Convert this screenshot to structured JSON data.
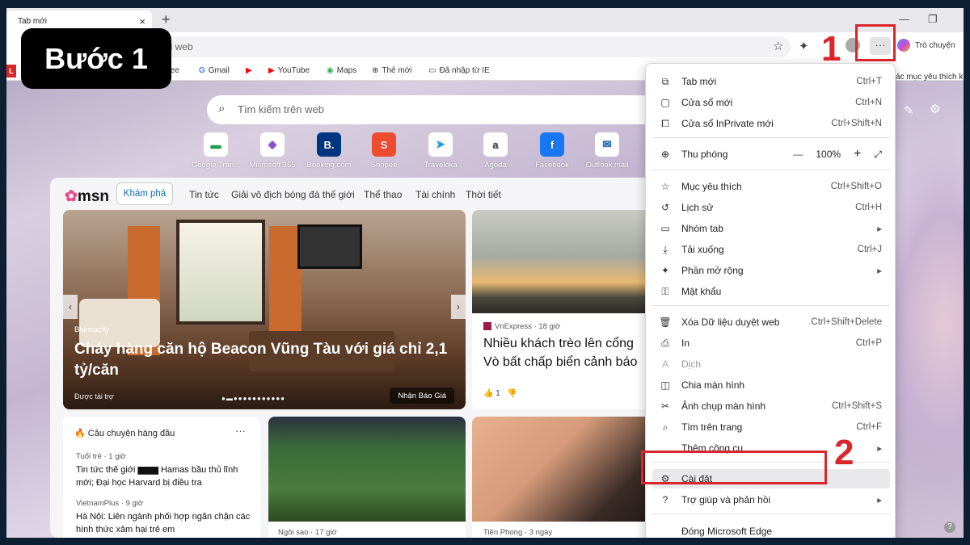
{
  "badge": "Bước 1",
  "step_numbers": [
    "1",
    "2"
  ],
  "tab": {
    "title": "Tab mới",
    "close": "×",
    "new": "+"
  },
  "window": {
    "minimize": "—",
    "restore": "❐"
  },
  "address": {
    "text": "hi web"
  },
  "chat_label": "Trò chuyện",
  "bookmarks": [
    {
      "label": "fee"
    },
    {
      "label": "Gmail"
    },
    {
      "label": "YouTube"
    },
    {
      "label": "Maps"
    },
    {
      "label": "Thẻ mới"
    },
    {
      "label": "Đã nhập từ IE"
    }
  ],
  "bookmarks_right": "ác mục yêu thích khá",
  "search": {
    "placeholder": "Tìm kiếm trên web"
  },
  "quick_links": [
    {
      "label": "Google Tran...",
      "icon": "google-translate-icon",
      "glyph": "▬",
      "color": "#1a9e4b"
    },
    {
      "label": "Microsoft 365",
      "icon": "m365-icon",
      "glyph": "◆",
      "color": "#8e4ccf"
    },
    {
      "label": "Booking.com",
      "icon": "booking-icon",
      "glyph": "B.",
      "color": "#003580"
    },
    {
      "label": "Shopee",
      "icon": "shopee-icon",
      "glyph": "S",
      "color": "#ee4d2d"
    },
    {
      "label": "Traveloka",
      "icon": "traveloka-icon",
      "glyph": "➤",
      "color": "#1ba0e2"
    },
    {
      "label": "Agoda",
      "icon": "agoda-icon",
      "glyph": "a",
      "color": "#444"
    },
    {
      "label": "Facebook",
      "icon": "facebook-icon",
      "glyph": "f",
      "color": "#1877f2"
    },
    {
      "label": "Outlook mail",
      "icon": "outlook-icon",
      "glyph": "✉",
      "color": "#0f6cbd"
    }
  ],
  "msn": {
    "logo": "msn",
    "nav": [
      "Khám phá",
      "Tin tức",
      "Giải vô địch bóng đá thế giới",
      "Thể thao",
      "Tài chính",
      "Thời tiết"
    ]
  },
  "hero": {
    "source": "Blancacity",
    "title": "Cháy hàng căn hộ Beacon Vũng Tàu với giá chỉ 2,1 tỷ/căn",
    "sponsored": "Được tài trợ",
    "cta": "Nhận Báo Giá",
    "dots": "●▬●●●●●●●●●●●"
  },
  "card2": {
    "source": "VnExpress · 18 giờ",
    "title_line1": "Nhiều khách trèo lên cổng",
    "title_line2": "Vò bất chấp biển cảnh báo",
    "likes": "1"
  },
  "top_stories": {
    "header": "Câu chuyện hàng đầu",
    "more": "···",
    "items": [
      {
        "source": "Tuổi trẻ · 1 giờ",
        "title": "Tin tức thế giới ▆▆▆ Hamas bầu thủ lĩnh mới; Đại học Harvard bị điều tra"
      },
      {
        "source": "VietnamPlus · 9 giờ",
        "title": "Hà Nội: Liên ngành phối hợp ngăn chặn các hình thức xâm hại trẻ em"
      }
    ]
  },
  "card4": {
    "source": "Ngôi sao · 17 giờ"
  },
  "card5": {
    "source": "Tiền Phong · 3 ngày"
  },
  "menu": {
    "items": [
      {
        "icon": "new-tab-icon",
        "glyph": "⧉",
        "label": "Tab mới",
        "shortcut": "Ctrl+T"
      },
      {
        "icon": "new-window-icon",
        "glyph": "▢",
        "label": "Cửa sổ mới",
        "shortcut": "Ctrl+N"
      },
      {
        "icon": "inprivate-icon",
        "glyph": "⧠",
        "label": "Cửa sổ InPrivate mới",
        "shortcut": "Ctrl+Shift+N"
      },
      {
        "icon": "favorites-icon",
        "glyph": "☆",
        "label": "Mục yêu thích",
        "shortcut": "Ctrl+Shift+O"
      },
      {
        "icon": "history-icon",
        "glyph": "↺",
        "label": "Lịch sử",
        "shortcut": "Ctrl+H"
      },
      {
        "icon": "tab-groups-icon",
        "glyph": "▭",
        "label": "Nhóm tab",
        "shortcut": "▸"
      },
      {
        "icon": "download-icon",
        "glyph": "⤓",
        "label": "Tải xuống",
        "shortcut": "Ctrl+J"
      },
      {
        "icon": "extensions-icon",
        "glyph": "✦",
        "label": "Phần mở rộng",
        "shortcut": "▸"
      },
      {
        "icon": "password-icon",
        "glyph": "⚿",
        "label": "Mật khẩu",
        "shortcut": ""
      },
      {
        "icon": "delete-icon",
        "glyph": "🗑",
        "label": "Xóa Dữ liệu duyệt web",
        "shortcut": "Ctrl+Shift+Delete"
      },
      {
        "icon": "print-icon",
        "glyph": "⎙",
        "label": "In",
        "shortcut": "Ctrl+P"
      },
      {
        "icon": "translate-icon",
        "glyph": "A",
        "label": "Dịch",
        "shortcut": ""
      },
      {
        "icon": "split-screen-icon",
        "glyph": "◫",
        "label": "Chia màn hình",
        "shortcut": ""
      },
      {
        "icon": "screenshot-icon",
        "glyph": "✂",
        "label": "Ảnh chụp màn hình",
        "shortcut": "Ctrl+Shift+S"
      },
      {
        "icon": "find-icon",
        "glyph": "⌕",
        "label": "Tìm trên trang",
        "shortcut": "Ctrl+F"
      },
      {
        "icon": "more-tools-icon",
        "glyph": "",
        "label": "Thêm công cụ",
        "shortcut": "▸"
      },
      {
        "icon": "settings-icon",
        "glyph": "⚙",
        "label": "Cài đặt",
        "shortcut": ""
      },
      {
        "icon": "help-icon",
        "glyph": "?",
        "label": "Trợ giúp và phản hồi",
        "shortcut": "▸"
      },
      {
        "icon": "close-edge-icon",
        "glyph": "",
        "label": "Đóng Microsoft Edge",
        "shortcut": ""
      }
    ],
    "zoom": {
      "label": "Thu phóng",
      "minus": "—",
      "value": "100%",
      "plus": "+",
      "fullscreen": "⤢"
    }
  },
  "colors": {
    "highlight": "#d9262b",
    "accent": "#0f6cbd"
  }
}
